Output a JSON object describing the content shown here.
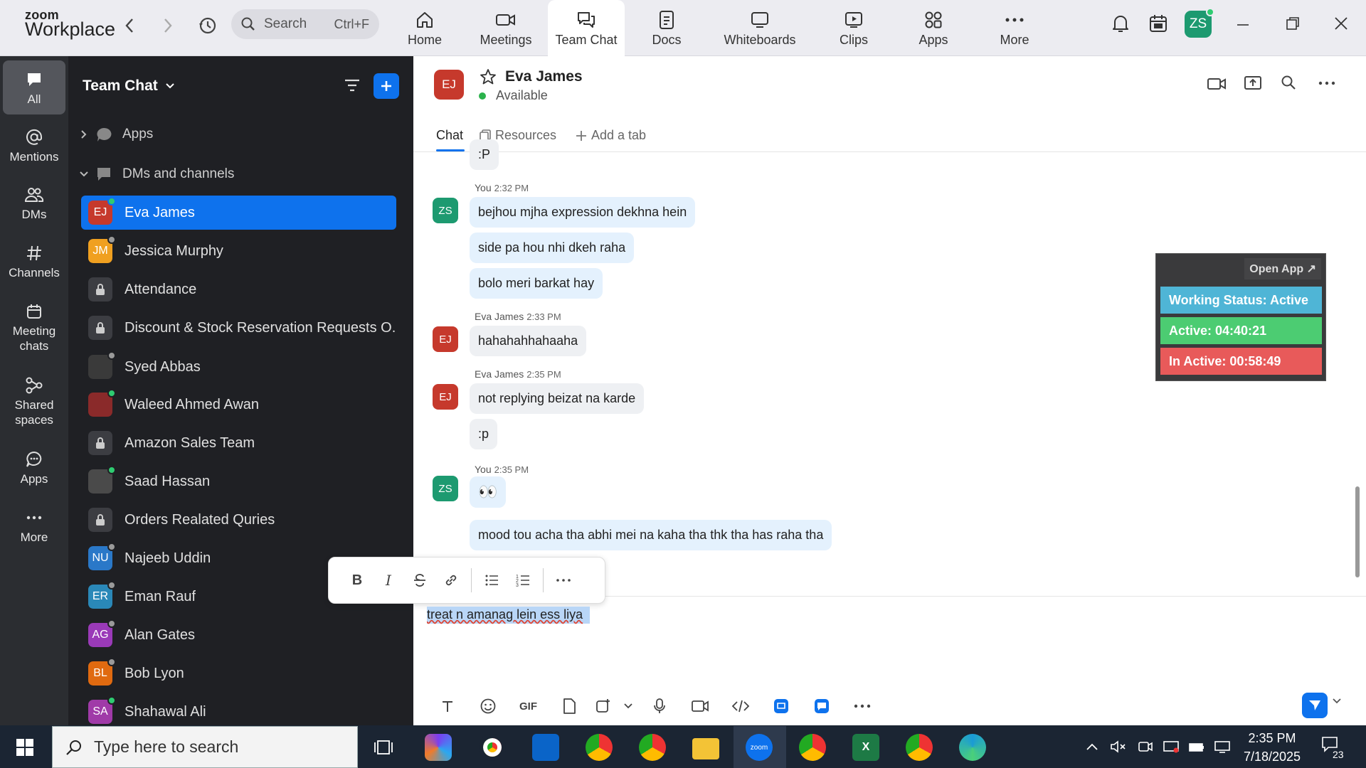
{
  "app": {
    "logo_line1": "zoom",
    "logo_line2": "Workplace"
  },
  "topbar": {
    "search_label": "Search",
    "search_hint": "Ctrl+F",
    "tabs": [
      {
        "label": "Home",
        "icon": "home-icon"
      },
      {
        "label": "Meetings",
        "icon": "video-camera-icon"
      },
      {
        "label": "Team Chat",
        "icon": "chat-bubbles-icon",
        "active": true
      },
      {
        "label": "Docs",
        "icon": "document-icon"
      },
      {
        "label": "Whiteboards",
        "icon": "whiteboard-icon"
      },
      {
        "label": "Clips",
        "icon": "clips-icon"
      },
      {
        "label": "Apps",
        "icon": "apps-icon"
      },
      {
        "label": "More",
        "icon": "more-dots-icon"
      }
    ],
    "avatar": "ZS"
  },
  "rail": {
    "items": [
      {
        "label": "All",
        "icon": "chat-icon"
      },
      {
        "label": "Mentions",
        "icon": "at-icon"
      },
      {
        "label": "DMs",
        "icon": "people-icon"
      },
      {
        "label": "Channels",
        "icon": "hash-icon"
      },
      {
        "label": "Meeting chats",
        "icon": "calendar-icon"
      },
      {
        "label": "Shared spaces",
        "icon": "shared-spaces-icon"
      },
      {
        "label": "Apps",
        "icon": "apps-chat-icon"
      },
      {
        "label": "More",
        "icon": "more-dots-icon"
      }
    ]
  },
  "sidebar": {
    "title": "Team Chat",
    "sections": [
      {
        "label": "Apps"
      },
      {
        "label": "DMs and channels"
      }
    ],
    "rows": [
      {
        "label": "Eva James",
        "initials": "EJ",
        "color": "#c6392c",
        "status": "#2ecc71",
        "selected": true
      },
      {
        "label": "Jessica Murphy",
        "initials": "JM",
        "color": "#f0a020",
        "status": "#9a9a9a"
      },
      {
        "label": "Attendance",
        "lock": true
      },
      {
        "label": "Discount & Stock Reservation Requests O...",
        "lock": true
      },
      {
        "label": "Syed Abbas",
        "initials": "",
        "color": "#3a3a3a",
        "status": "#9a9a9a"
      },
      {
        "label": "Waleed Ahmed Awan",
        "initials": "",
        "color": "#8a2a2a",
        "status": "#2ecc71"
      },
      {
        "label": "Amazon Sales Team",
        "lock": true
      },
      {
        "label": "Saad Hassan",
        "initials": "",
        "color": "#4a4a4a",
        "status": "#2ecc71"
      },
      {
        "label": "Orders Realated Quries",
        "lock": true
      },
      {
        "label": "Najeeb Uddin",
        "initials": "NU",
        "color": "#2a78c8",
        "status": "#9a9a9a"
      },
      {
        "label": "Eman Rauf",
        "initials": "ER",
        "color": "#2a88b8",
        "status": "#9a9a9a"
      },
      {
        "label": "Alan Gates",
        "initials": "AG",
        "color": "#9a3ab8",
        "status": "#9a9a9a"
      },
      {
        "label": "Bob Lyon",
        "initials": "BL",
        "color": "#e06a10",
        "status": "#9a9a9a"
      },
      {
        "label": "Shahawal Ali",
        "initials": "SA",
        "color": "#a03aa8",
        "status": "#2ecc71"
      }
    ]
  },
  "chat": {
    "contact": {
      "name": "Eva James",
      "initials": "EJ",
      "status": "Available"
    },
    "tabs": {
      "chat": "Chat",
      "resources": "Resources",
      "add": "Add a tab"
    },
    "groups": [
      {
        "sender": "",
        "time": "",
        "avatar": "",
        "bubbles": [
          ":P"
        ],
        "mine": false
      },
      {
        "sender": "You",
        "time": "2:32 PM",
        "avatar": "ZS",
        "bubbles": [
          "bejhou mjha expression dekhna hein",
          "side pa hou nhi dkeh raha",
          "bolo meri barkat hay"
        ],
        "mine": true
      },
      {
        "sender": "Eva James",
        "time": "2:33 PM",
        "avatar": "EJ",
        "bubbles": [
          "hahahahhahaaha"
        ],
        "mine": false
      },
      {
        "sender": "Eva James",
        "time": "2:35 PM",
        "avatar": "EJ",
        "bubbles": [
          "not replying beizat na karde",
          ":p"
        ],
        "mine": false
      },
      {
        "sender": "You",
        "time": "2:35 PM",
        "avatar": "ZS",
        "bubbles": [
          "👀",
          "mood tou acha tha abhi mei na kaha tha thk tha has raha tha"
        ],
        "mine": true
      }
    ],
    "composer_text": "treat n amanag lein ess liya"
  },
  "widget": {
    "open_app": "Open App ↗",
    "rows": [
      {
        "label": "Working Status: Active",
        "color": "#4fb5d6"
      },
      {
        "label": "Active: 04:40:21",
        "color": "#4ccc72"
      },
      {
        "label": "In Active: 00:58:49",
        "color": "#e85a5a"
      }
    ]
  },
  "taskbar": {
    "search_placeholder": "Type here to search",
    "time": "2:35 PM",
    "date": "7/18/2025",
    "notifications": "23"
  }
}
